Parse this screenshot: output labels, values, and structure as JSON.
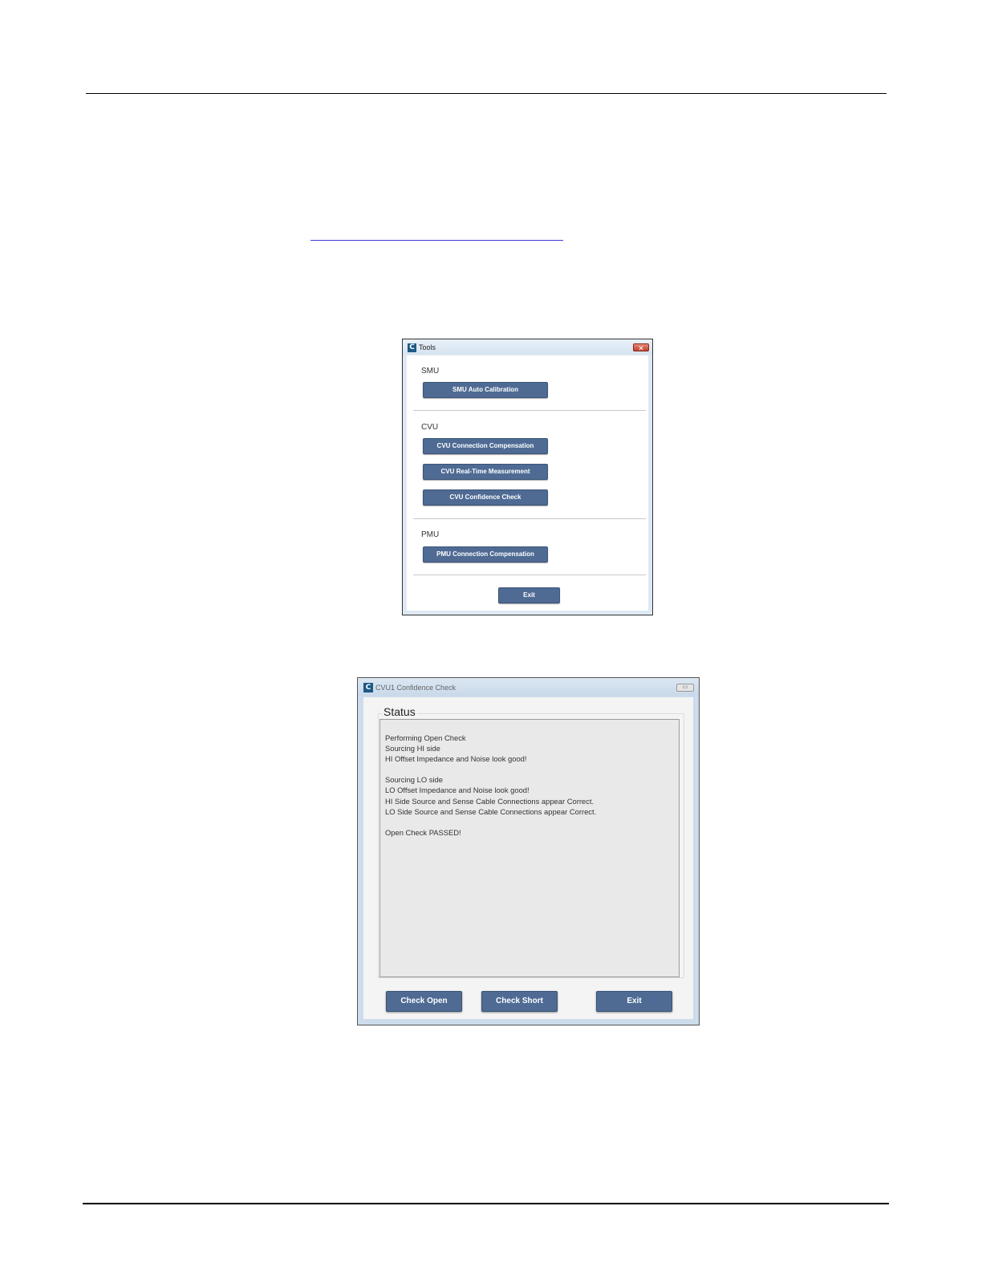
{
  "tools_window": {
    "title": "Tools",
    "close_glyph": "✕",
    "sections": [
      {
        "label": "SMU",
        "buttons": [
          "SMU Auto Calibration"
        ]
      },
      {
        "label": "CVU",
        "buttons": [
          "CVU Connection Compensation",
          "CVU Real-Time Measurement",
          "CVU Confidence Check"
        ]
      },
      {
        "label": "PMU",
        "buttons": [
          "PMU Connection Compensation"
        ]
      }
    ],
    "exit_label": "Exit"
  },
  "cvu_window": {
    "title": "CVU1 Confidence Check",
    "status_label": "Status",
    "status_lines": [
      "Performing Open Check",
      "Sourcing HI side",
      "HI Offset Impedance and Noise look good!",
      "",
      "Sourcing LO side",
      "LO Offset Impedance and Noise look good!",
      "HI Side Source and Sense Cable Connections appear Correct.",
      "LO Side Source and Sense Cable Connections appear Correct.",
      "",
      "Open Check PASSED!"
    ],
    "buttons": {
      "check_open": "Check Open",
      "check_short": "Check Short",
      "exit": "Exit"
    }
  },
  "icons": {
    "app_icon_glyph": "C",
    "app_icon_color": "#1c5a86",
    "button_color": "#4f6b94"
  }
}
